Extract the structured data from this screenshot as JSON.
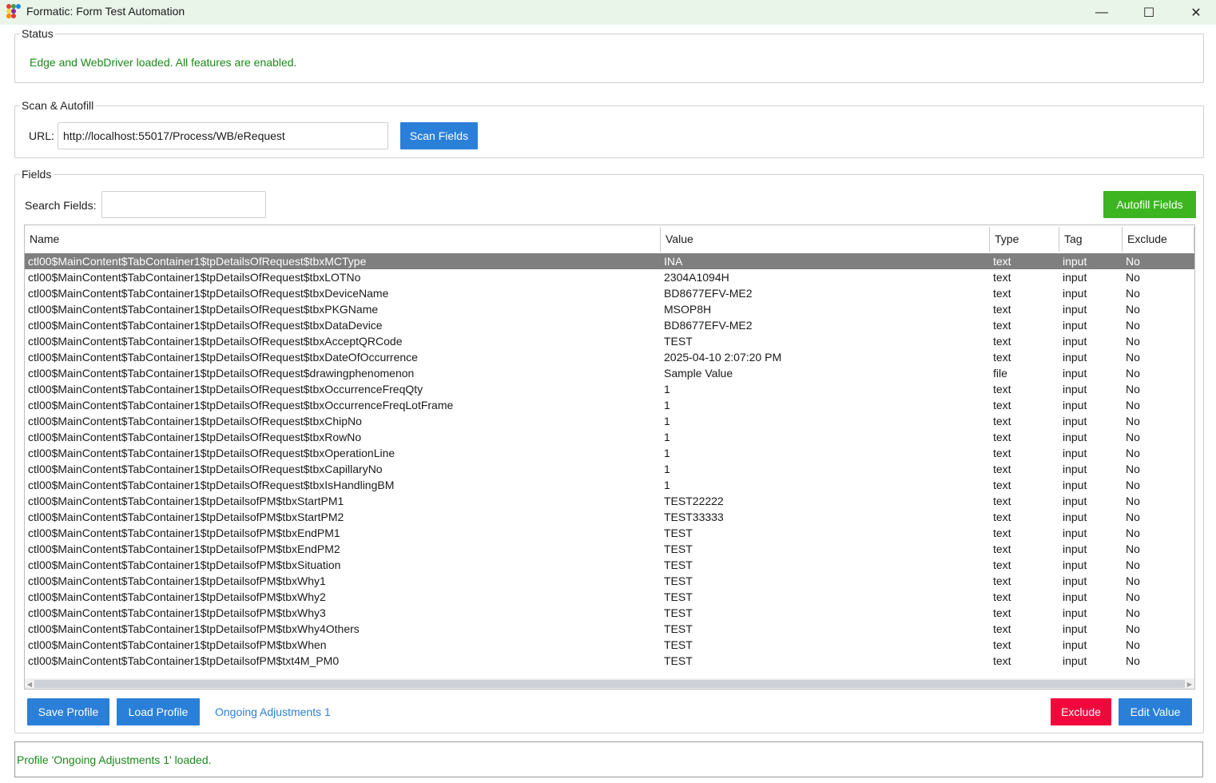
{
  "window": {
    "title": "Formatic: Form Test Automation",
    "minimize_glyph": "—",
    "maximize_glyph": "☐",
    "close_glyph": "✕"
  },
  "status": {
    "legend": "Status",
    "message": "Edge and WebDriver loaded. All features are enabled."
  },
  "scan": {
    "legend": "Scan & Autofill",
    "url_label": "URL:",
    "url_value": "http://localhost:55017/Process/WB/eRequest",
    "scan_button": "Scan Fields"
  },
  "fields": {
    "legend": "Fields",
    "search_label": "Search Fields:",
    "search_value": "",
    "autofill_button": "Autofill Fields",
    "columns": [
      "Name",
      "Value",
      "Type",
      "Tag",
      "Exclude"
    ],
    "selected_index": 0,
    "rows": [
      [
        "ctl00$MainContent$TabContainer1$tpDetailsOfRequest$tbxMCType",
        "INA",
        "text",
        "input",
        "No"
      ],
      [
        "ctl00$MainContent$TabContainer1$tpDetailsOfRequest$tbxLOTNo",
        "2304A1094H",
        "text",
        "input",
        "No"
      ],
      [
        "ctl00$MainContent$TabContainer1$tpDetailsOfRequest$tbxDeviceName",
        "BD8677EFV-ME2",
        "text",
        "input",
        "No"
      ],
      [
        "ctl00$MainContent$TabContainer1$tpDetailsOfRequest$tbxPKGName",
        "MSOP8H",
        "text",
        "input",
        "No"
      ],
      [
        "ctl00$MainContent$TabContainer1$tpDetailsOfRequest$tbxDataDevice",
        "BD8677EFV-ME2",
        "text",
        "input",
        "No"
      ],
      [
        "ctl00$MainContent$TabContainer1$tpDetailsOfRequest$tbxAcceptQRCode",
        "TEST",
        "text",
        "input",
        "No"
      ],
      [
        "ctl00$MainContent$TabContainer1$tpDetailsOfRequest$tbxDateOfOccurrence",
        "2025-04-10 2:07:20 PM",
        "text",
        "input",
        "No"
      ],
      [
        "ctl00$MainContent$TabContainer1$tpDetailsOfRequest$drawingphenomenon",
        "Sample Value",
        "file",
        "input",
        "No"
      ],
      [
        "ctl00$MainContent$TabContainer1$tpDetailsOfRequest$tbxOccurrenceFreqQty",
        "1",
        "text",
        "input",
        "No"
      ],
      [
        "ctl00$MainContent$TabContainer1$tpDetailsOfRequest$tbxOccurrenceFreqLotFrame",
        "1",
        "text",
        "input",
        "No"
      ],
      [
        "ctl00$MainContent$TabContainer1$tpDetailsOfRequest$tbxChipNo",
        "1",
        "text",
        "input",
        "No"
      ],
      [
        "ctl00$MainContent$TabContainer1$tpDetailsOfRequest$tbxRowNo",
        "1",
        "text",
        "input",
        "No"
      ],
      [
        "ctl00$MainContent$TabContainer1$tpDetailsOfRequest$tbxOperationLine",
        "1",
        "text",
        "input",
        "No"
      ],
      [
        "ctl00$MainContent$TabContainer1$tpDetailsOfRequest$tbxCapillaryNo",
        "1",
        "text",
        "input",
        "No"
      ],
      [
        "ctl00$MainContent$TabContainer1$tpDetailsOfRequest$tbxIsHandlingBM",
        "1",
        "text",
        "input",
        "No"
      ],
      [
        "ctl00$MainContent$TabContainer1$tpDetailsofPM$tbxStartPM1",
        "TEST22222",
        "text",
        "input",
        "No"
      ],
      [
        "ctl00$MainContent$TabContainer1$tpDetailsofPM$tbxStartPM2",
        "TEST33333",
        "text",
        "input",
        "No"
      ],
      [
        "ctl00$MainContent$TabContainer1$tpDetailsofPM$tbxEndPM1",
        "TEST",
        "text",
        "input",
        "No"
      ],
      [
        "ctl00$MainContent$TabContainer1$tpDetailsofPM$tbxEndPM2",
        "TEST",
        "text",
        "input",
        "No"
      ],
      [
        "ctl00$MainContent$TabContainer1$tpDetailsofPM$tbxSituation",
        "TEST",
        "text",
        "input",
        "No"
      ],
      [
        "ctl00$MainContent$TabContainer1$tpDetailsofPM$tbxWhy1",
        "TEST",
        "text",
        "input",
        "No"
      ],
      [
        "ctl00$MainContent$TabContainer1$tpDetailsofPM$tbxWhy2",
        "TEST",
        "text",
        "input",
        "No"
      ],
      [
        "ctl00$MainContent$TabContainer1$tpDetailsofPM$tbxWhy3",
        "TEST",
        "text",
        "input",
        "No"
      ],
      [
        "ctl00$MainContent$TabContainer1$tpDetailsofPM$tbxWhy4Others",
        "TEST",
        "text",
        "input",
        "No"
      ],
      [
        "ctl00$MainContent$TabContainer1$tpDetailsofPM$tbxWhen",
        "TEST",
        "text",
        "input",
        "No"
      ],
      [
        "ctl00$MainContent$TabContainer1$tpDetailsofPM$txt4M_PM0",
        "TEST",
        "text",
        "input",
        "No"
      ]
    ],
    "save_profile_button": "Save Profile",
    "load_profile_button": "Load Profile",
    "current_profile": "Ongoing Adjustments 1",
    "exclude_button": "Exclude",
    "edit_value_button": "Edit Value"
  },
  "footer": {
    "message": "Profile 'Ongoing Adjustments 1' loaded."
  },
  "colors": {
    "accent_blue": "#2a7fd9",
    "autofill_green": "#3cb521",
    "exclude_red": "#f1073c",
    "status_green": "#1a8a1a",
    "selected_row": "#7f7f7f",
    "titlebar_bg": "#eaf5ea"
  },
  "icons": {
    "app": "formatic-app-icon",
    "minimize": "minimize-icon",
    "maximize": "maximize-icon",
    "close": "close-icon"
  }
}
